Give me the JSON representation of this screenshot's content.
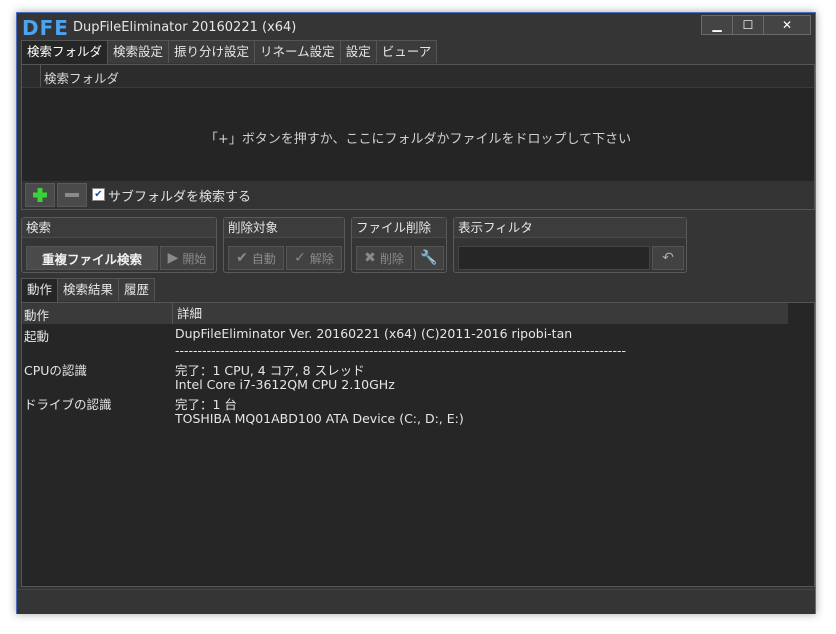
{
  "window": {
    "logo": "DFE",
    "title": "DupFileEliminator 20160221 (x64)",
    "controls": {
      "minimize": "▁",
      "maximize": "☐",
      "close": "✕"
    }
  },
  "main_tabs": [
    "検索フォルダ",
    "検索設定",
    "振り分け設定",
    "リネーム設定",
    "設定",
    "ビューア"
  ],
  "folder_panel": {
    "column_header": "検索フォルダ",
    "hint": "「+」ボタンを押すか、ここにフォルダかファイルをドロップして下さい",
    "subfolder_checkbox_label": "サブフォルダを検索する",
    "subfolder_checked": true
  },
  "groups": {
    "search": {
      "title": "検索",
      "duplicate_search": "重複ファイル検索",
      "start": "開始"
    },
    "delete_target": {
      "title": "削除対象",
      "auto": "自動",
      "release": "解除"
    },
    "file_delete": {
      "title": "ファイル削除",
      "delete": "削除"
    },
    "display_filter": {
      "title": "表示フィルタ"
    }
  },
  "sub_tabs": [
    "動作",
    "検索結果",
    "履歴"
  ],
  "log": {
    "headers": [
      "動作",
      "詳細"
    ],
    "rows": [
      {
        "action": "起動",
        "detail": "DupFileEliminator Ver. 20160221 (x64) (C)2011-2016 ripobi-tan"
      },
      {
        "action": "",
        "detail": "----------------------------------------------------------------------------------------------------"
      },
      {
        "action": "CPUの認識",
        "detail": "完了：1 CPU, 4 コア, 8 スレッド"
      },
      {
        "action": "",
        "detail": "Intel Core i7-3612QM CPU 2.10GHz"
      },
      {
        "action": "ドライブの認識",
        "detail": "完了：1 台"
      },
      {
        "action": "",
        "detail": "TOSHIBA MQ01ABD100 ATA Device (C:, D:, E:)"
      }
    ]
  },
  "colors": {
    "accent_logo": "#4ba3f2",
    "add_button": "#3bd13b",
    "window_border": "#4a6fbf"
  }
}
